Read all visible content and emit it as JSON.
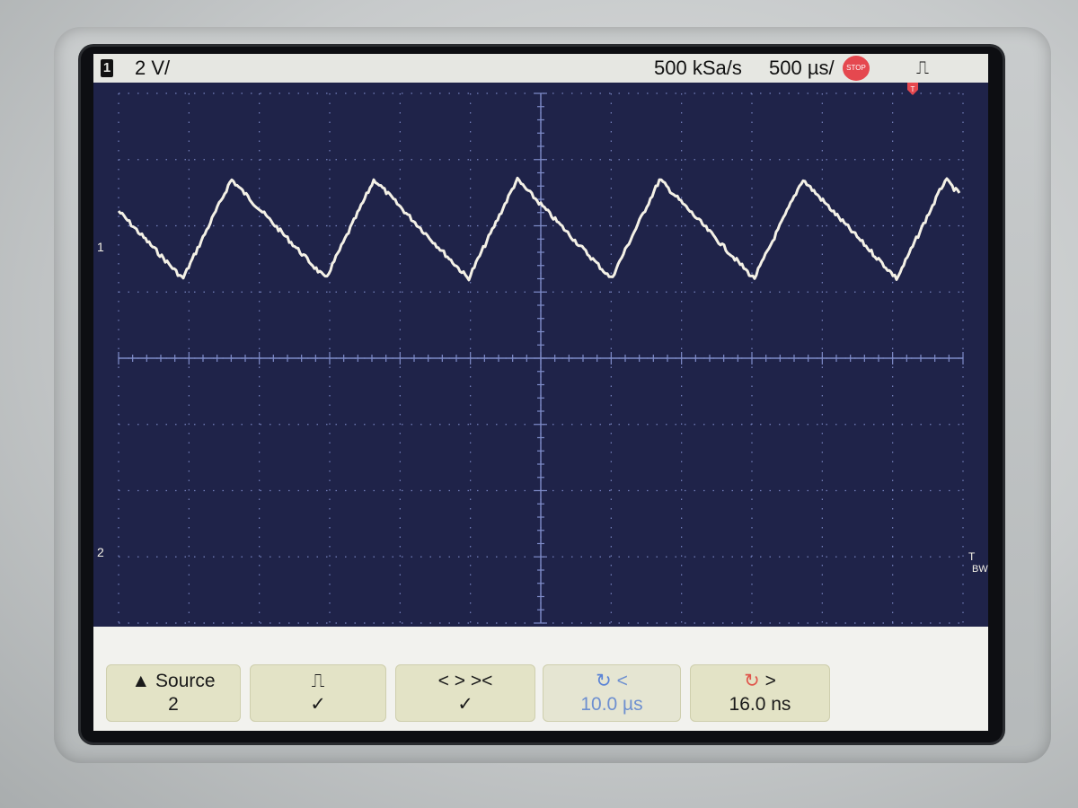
{
  "status_bar": {
    "channel_number": "1",
    "channel_scale": "2 V/",
    "sample_rate": "500 kSa/s",
    "timebase": "500 µs/",
    "run_state": "STOP",
    "trigger_mode_glyph": "⎍",
    "trigger_position_marker": "T"
  },
  "screen_markers": {
    "channel1_ground_marker": "1",
    "channel2_ground_marker": "2",
    "bw_limit_label": "BW",
    "trigger_level_marker": "T"
  },
  "softkeys": [
    {
      "line1": "▲ Source",
      "line2": "2",
      "enabled": true
    },
    {
      "line1": "⎍",
      "line2": "✓",
      "enabled": true
    },
    {
      "line1": "<  >  ><",
      "line2": "✓",
      "enabled": true
    },
    {
      "icon": "rotary-knob-icon",
      "line1": "<",
      "line2": "10.0 µs",
      "enabled": false
    },
    {
      "icon": "rotary-knob-icon",
      "line1": ">",
      "line2": "16.0 ns",
      "enabled": true
    }
  ],
  "colors": {
    "screen_bg": "#1f2349",
    "grid": "#7f8cc9",
    "trace": "#f4f1e6",
    "stop_badge": "#e5484f",
    "softkey_bg": "#e3e3c6"
  },
  "waveform": {
    "type": "sawtooth",
    "peaks_visible": 6,
    "levels": {
      "high_div": 1.3,
      "low_div": 2.8
    }
  }
}
